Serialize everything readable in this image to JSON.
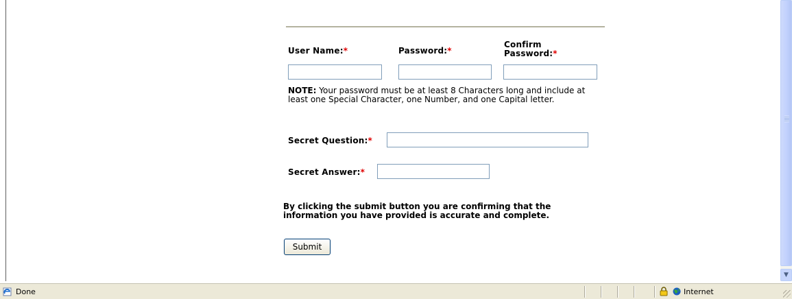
{
  "form": {
    "username_label": "User Name:",
    "password_label": "Password:",
    "confirm_label_line1": "Confirm",
    "confirm_label_line2": "Password:",
    "required_marker": "*",
    "note_bold": "NOTE:",
    "note_text": " Your password must be at least 8 Characters long and include at least one Special Character, one Number, and one Capital letter.",
    "secret_question_label": "Secret Question:",
    "secret_answer_label": "Secret Answer:",
    "username_value": "",
    "password_value": "",
    "confirm_password_value": "",
    "secret_question_value": "",
    "secret_answer_value": "",
    "confirmation_text": "By clicking the submit button you are confirming that the information you have provided is accurate and complete.",
    "submit_label": "Submit"
  },
  "statusbar": {
    "status_text": "Done",
    "zone_text": "Internet"
  },
  "colors": {
    "required": "#e00000",
    "input_border": "#7f9db9",
    "rule": "#b4b29f",
    "statusbar_bg": "#ece9d8"
  }
}
